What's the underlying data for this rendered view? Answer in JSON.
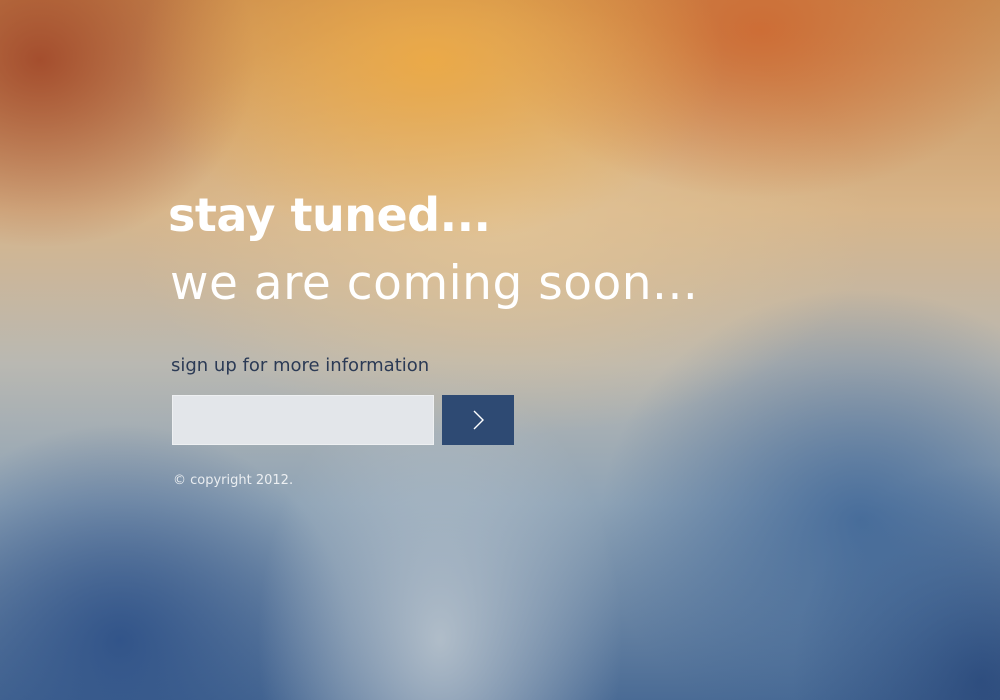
{
  "page": {
    "title": "stay tuned...",
    "subtitle": "we are coming soon...",
    "signup_label": "sign up for more information",
    "copyright": "© copyright 2012."
  },
  "form": {
    "email_value": "",
    "email_placeholder": "",
    "submit_icon": "chevron-right-icon"
  },
  "colors": {
    "button": "#2e4a73",
    "input": "#e3e6ea",
    "label": "#2b3a55",
    "heading": "#ffffff"
  }
}
